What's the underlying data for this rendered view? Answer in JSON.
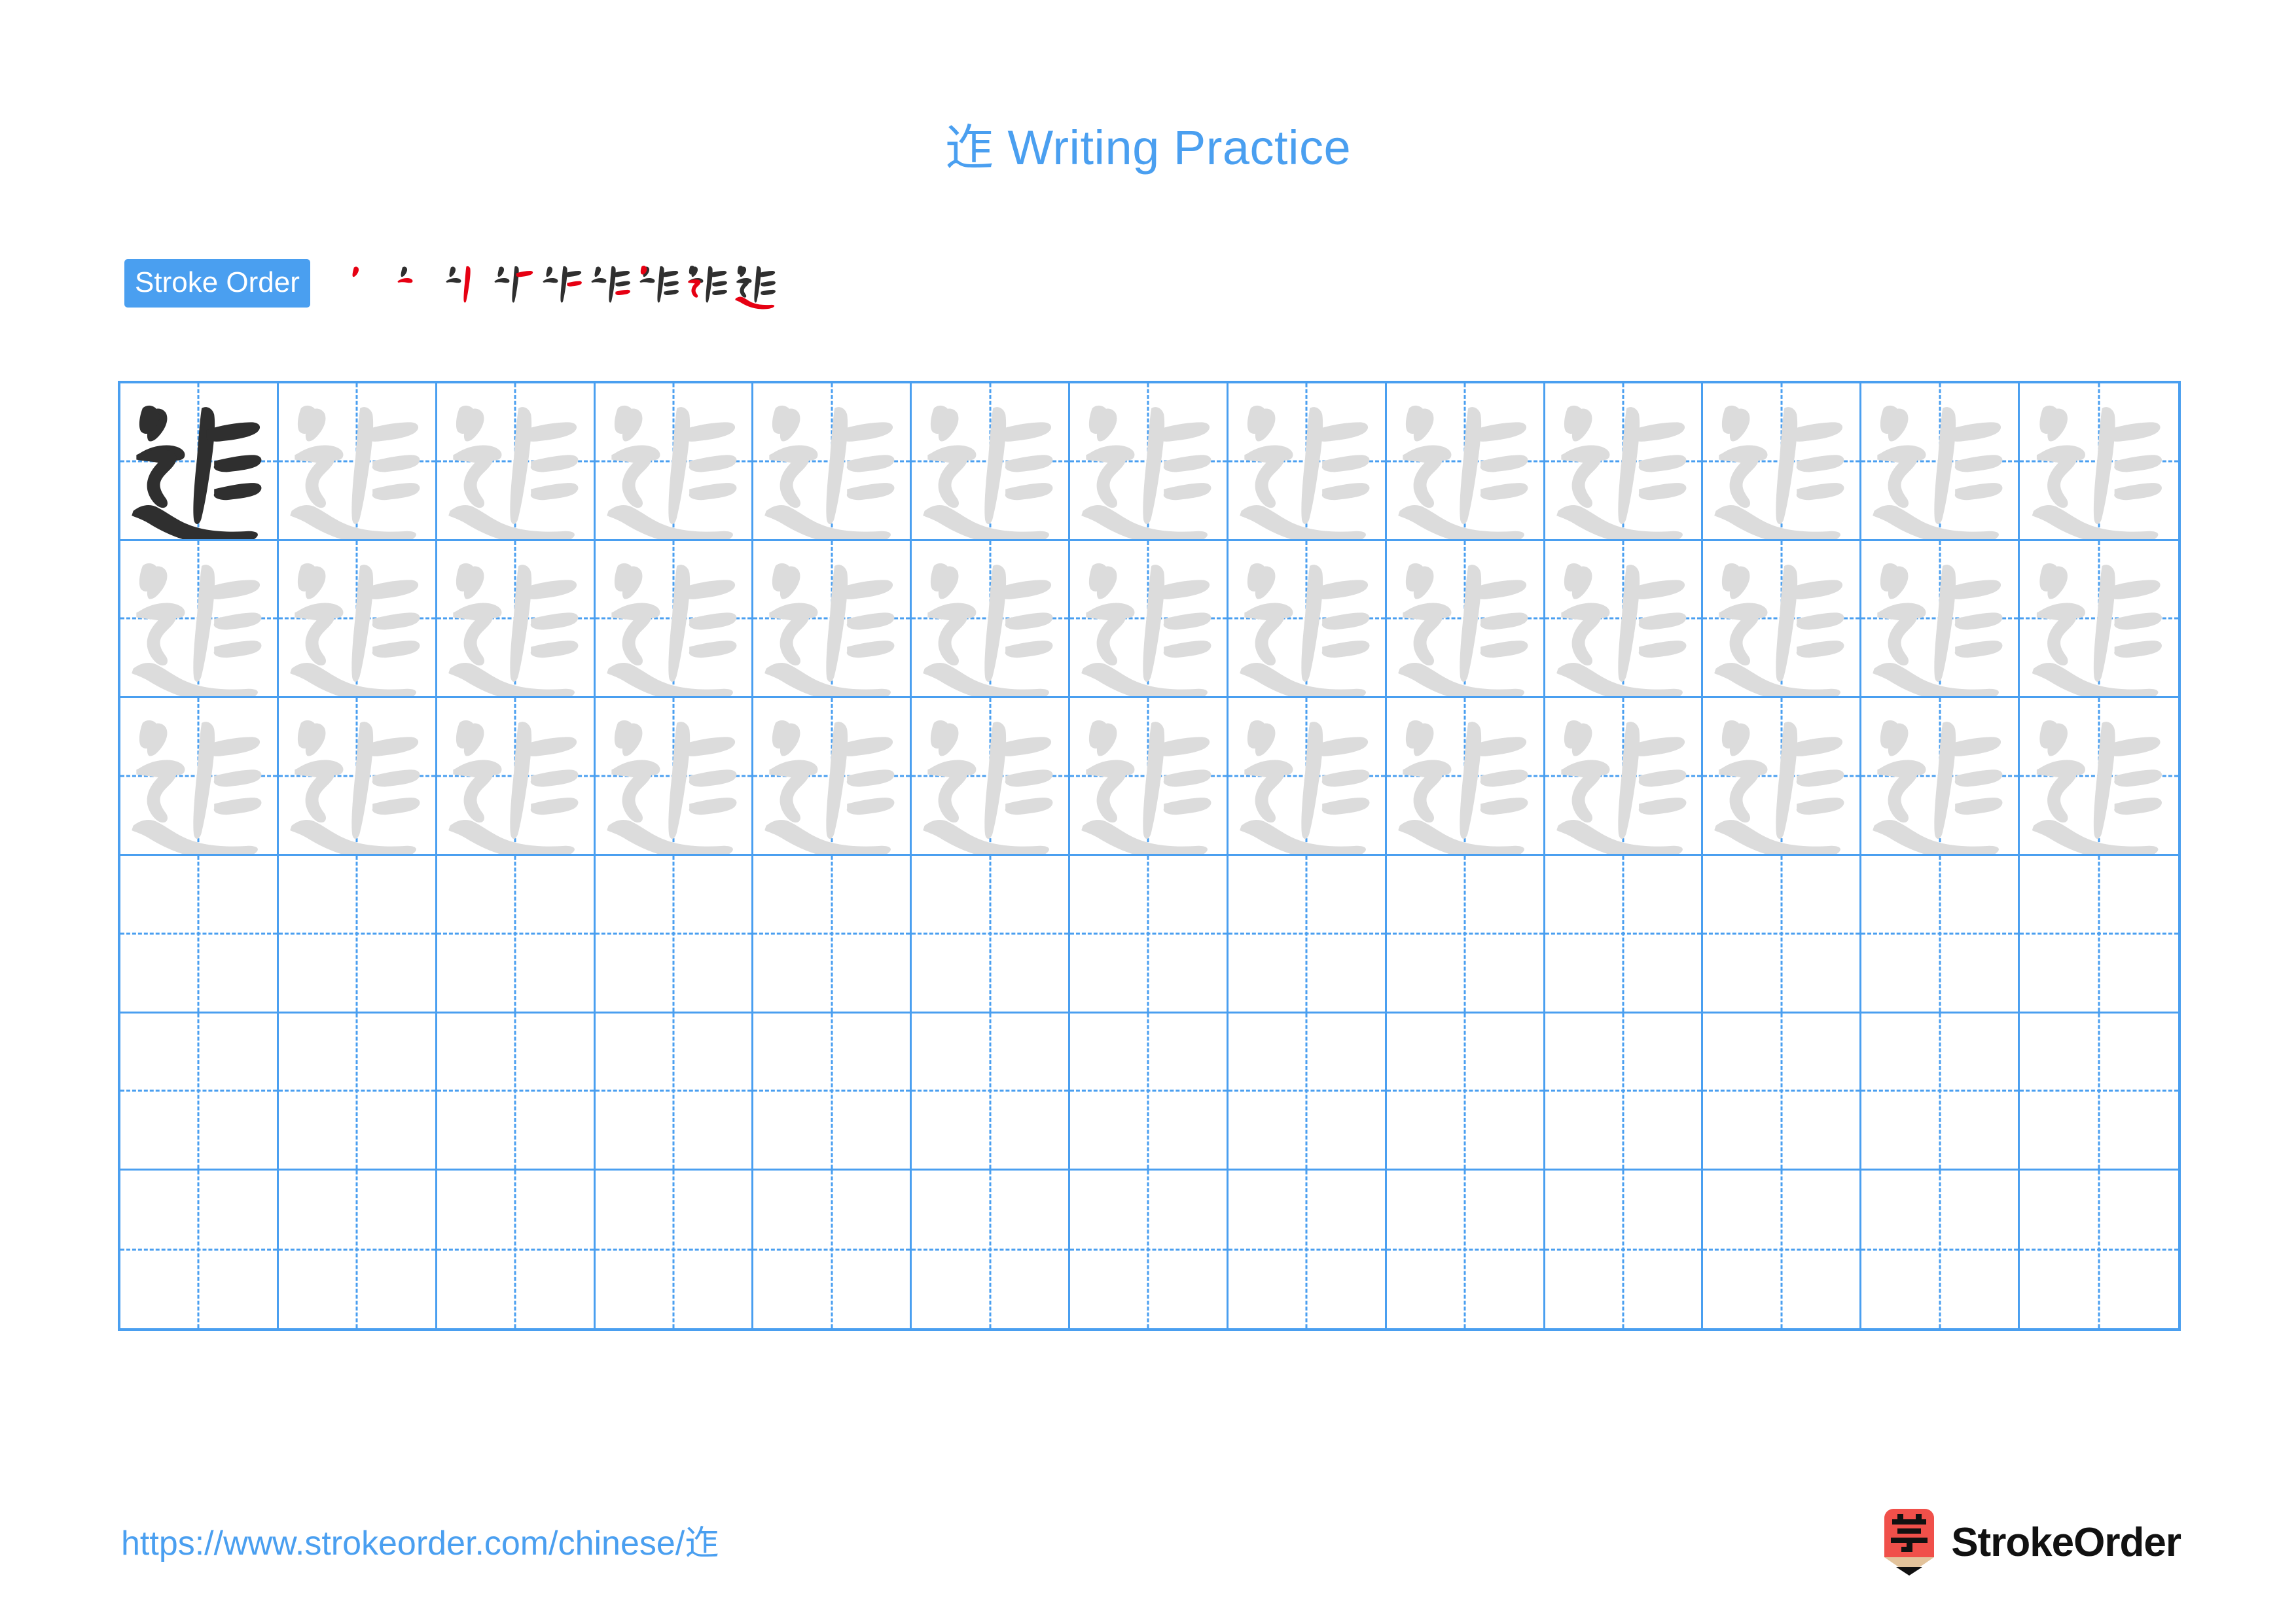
{
  "page": {
    "character": "迮",
    "title_suffix": " Writing Practice",
    "background_color": "#ffffff",
    "accent_color": "#4a9ff0",
    "trace_color": "#dcdcdc",
    "ink_color": "#2f2f2f",
    "highlight_stroke_color": "#e60012"
  },
  "title": {
    "character": "迮",
    "text": " Writing Practice"
  },
  "stroke_order": {
    "badge_label": "Stroke Order",
    "total_strokes": 9,
    "steps": [
      {
        "index": 1,
        "name": "stroke-step-1",
        "stroke_count": 1
      },
      {
        "index": 2,
        "name": "stroke-step-2",
        "stroke_count": 2
      },
      {
        "index": 3,
        "name": "stroke-step-3",
        "stroke_count": 3
      },
      {
        "index": 4,
        "name": "stroke-step-4",
        "stroke_count": 4
      },
      {
        "index": 5,
        "name": "stroke-step-5",
        "stroke_count": 5
      },
      {
        "index": 6,
        "name": "stroke-step-6",
        "stroke_count": 6
      },
      {
        "index": 7,
        "name": "stroke-step-7",
        "stroke_count": 7
      },
      {
        "index": 8,
        "name": "stroke-step-8",
        "stroke_count": 8
      },
      {
        "index": 9,
        "name": "stroke-step-9",
        "stroke_count": 9
      }
    ]
  },
  "grid": {
    "columns": 13,
    "rows": 6,
    "model_cell": {
      "row": 1,
      "column": 1,
      "style": "ink"
    },
    "traced_rows": [
      1,
      2,
      3
    ],
    "blank_rows": [
      4,
      5,
      6
    ],
    "guide_line_style": "dashed-cross"
  },
  "footer": {
    "url_prefix": "https://www.strokeorder.com/chinese/",
    "url_character": "迮",
    "brand_name": "StrokeOrder",
    "brand_mark_character": "字",
    "brand_mark_color": "#f0504a",
    "brand_mark_wood_color": "#e3c39b"
  }
}
